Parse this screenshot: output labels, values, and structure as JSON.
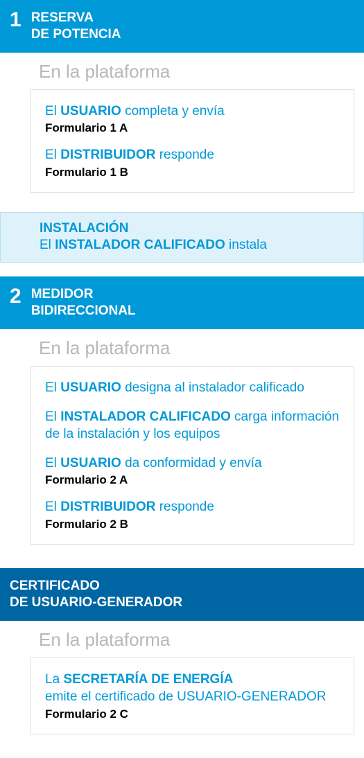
{
  "sections": [
    {
      "num": "1",
      "title": "RESERVA\nDE POTENCIA",
      "header_class": "blue-light",
      "platform": "En la plataforma",
      "items": [
        {
          "prefix": "El ",
          "bold": "USUARIO",
          "suffix": " completa y envía",
          "sub": "Formulario 1 A"
        },
        {
          "prefix": "El ",
          "bold": "DISTRIBUIDOR",
          "suffix": " responde",
          "sub": "Formulario 1 B"
        }
      ],
      "banner": {
        "title": "INSTALACIÓN",
        "prefix": "El ",
        "bold": "INSTALADOR CALIFICADO",
        "suffix": " instala"
      }
    },
    {
      "num": "2",
      "title": "MEDIDOR\nBIDIRECCIONAL",
      "header_class": "blue-light",
      "platform": "En la plataforma",
      "items": [
        {
          "prefix": "El ",
          "bold": "USUARIO",
          "suffix": " designa al instalador calificado",
          "sub": ""
        },
        {
          "prefix": "El ",
          "bold": "INSTALADOR CALIFICADO",
          "suffix": " carga información de la instalación y los equipos",
          "sub": ""
        },
        {
          "prefix": "El ",
          "bold": "USUARIO",
          "suffix": " da conformidad y envía",
          "sub": "Formulario 2 A"
        },
        {
          "prefix": "El ",
          "bold": "DISTRIBUIDOR",
          "suffix": " responde",
          "sub": "Formulario 2 B"
        }
      ]
    },
    {
      "num": "",
      "title": "CERTIFICADO\nDE USUARIO-GENERADOR",
      "header_class": "blue-dark",
      "platform": "En la plataforma",
      "items": [
        {
          "prefix": "La ",
          "bold": "SECRETARÍA DE ENERGÍA",
          "suffix": "\nemite el certificado de USUARIO-GENERADOR",
          "sub": "Formulario 2 C"
        }
      ]
    }
  ]
}
